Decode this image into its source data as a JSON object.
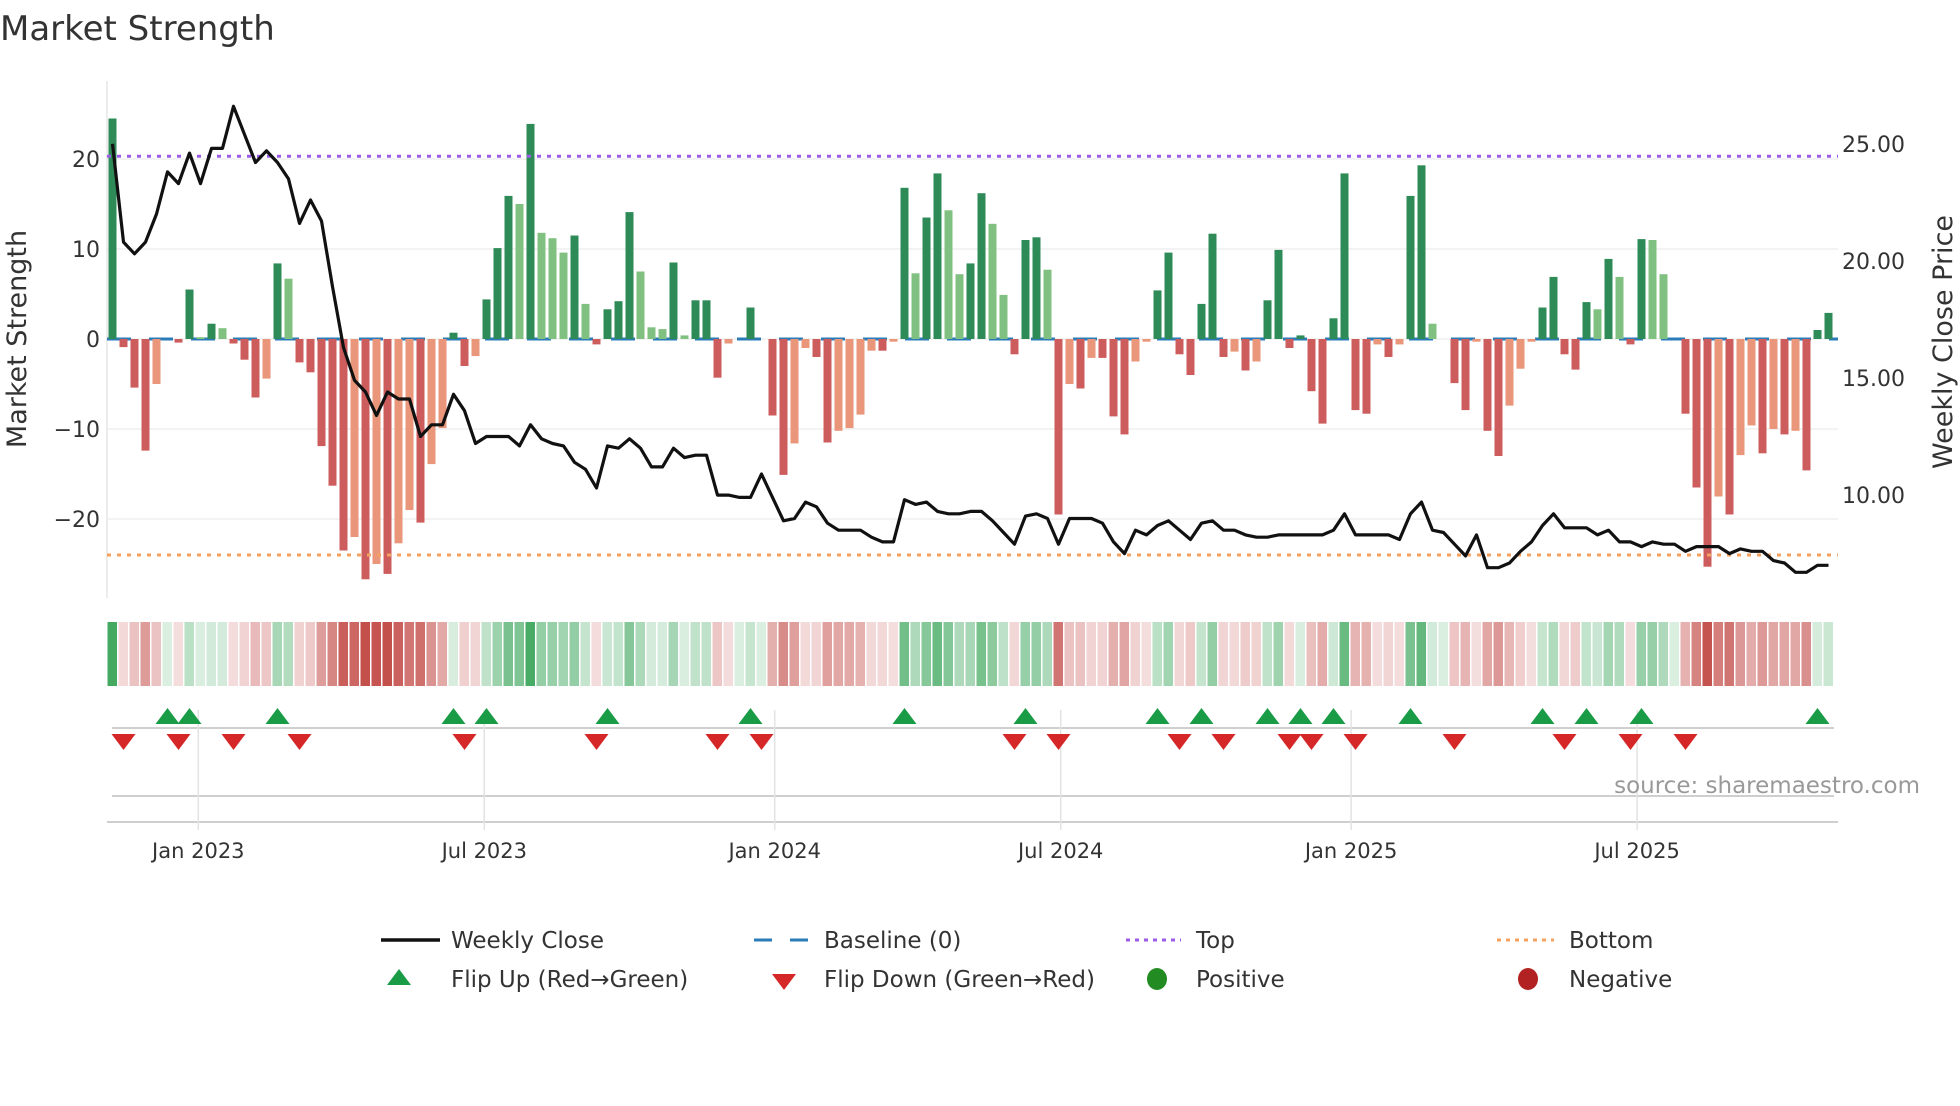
{
  "title": "Market Strength",
  "source": "source: sharemaestro.com",
  "colors": {
    "strong_pos": "#2e8b57",
    "weak_pos": "#80c080",
    "strong_neg": "#cd5c5c",
    "weak_neg": "#e9967a",
    "baseline": "#2b7bb9",
    "top": "#9b5de5",
    "bottom": "#f4a261",
    "close": "#111111",
    "flip_up": "#1a9c47",
    "flip_down": "#d62728",
    "positive": "#228b22",
    "negative": "#b22222"
  },
  "legend": {
    "weekly_close": "Weekly Close",
    "baseline": "Baseline (0)",
    "top": "Top",
    "bottom": "Bottom",
    "flip_up": "Flip Up (Red→Green)",
    "flip_down": "Flip Down (Green→Red)",
    "positive": "Positive",
    "negative": "Negative"
  },
  "chart_data": {
    "type": "bar",
    "title": "Market Strength",
    "ylabel": "Market Strength",
    "y2label": "Weekly Close Price",
    "ylim": [
      -28.7,
      28.6
    ],
    "y2lim": [
      5.6,
      27.7
    ],
    "yticks": [
      "20",
      "10",
      "0",
      "−10",
      "−20"
    ],
    "ytick_values": [
      20,
      10,
      0,
      -10,
      -20
    ],
    "y2ticks": [
      "25.00",
      "20.00",
      "15.00",
      "10.00"
    ],
    "y2tick_values": [
      25,
      20,
      15,
      10
    ],
    "xticks": [
      "Jan 2023",
      "Jul 2023",
      "Jan 2024",
      "Jul 2024",
      "Jan 2025",
      "Jul 2025"
    ],
    "xtick_week_index": [
      7.8,
      33.8,
      60.2,
      86.2,
      112.6,
      138.6
    ],
    "top_level": 20.3,
    "bottom_level": -24,
    "baseline": 0,
    "strength": [
      24.5,
      -0.9,
      -5.4,
      -12.4,
      -5,
      0,
      -0.4,
      5.5,
      0.2,
      1.7,
      1.2,
      -0.5,
      -2.3,
      -6.5,
      -4.4,
      8.4,
      6.7,
      -2.6,
      -3.7,
      -11.9,
      -16.3,
      -23.5,
      -22,
      -26.7,
      -25,
      -26.1,
      -22.7,
      -19,
      -20.4,
      -13.9,
      -9.9,
      0.7,
      -3,
      -1.9,
      4.4,
      10.1,
      15.9,
      15,
      23.9,
      11.8,
      11.2,
      9.6,
      11.5,
      3.9,
      -0.6,
      3.3,
      4.2,
      14.1,
      7.5,
      1.3,
      1.1,
      8.5,
      0.4,
      4.3,
      4.3,
      -4.3,
      -0.5,
      0,
      3.5,
      0,
      -8.5,
      -15.1,
      -11.6,
      -1,
      -2,
      -11.5,
      -10.2,
      -9.9,
      -8.4,
      -1.3,
      -1.3,
      -0.3,
      16.8,
      7.3,
      13.5,
      18.4,
      14.3,
      7.2,
      8.4,
      16.2,
      12.8,
      4.9,
      -1.7,
      11,
      11.3,
      7.7,
      -19.5,
      -5,
      -5.5,
      -2.1,
      -2.1,
      -8.6,
      -10.6,
      -2.5,
      -0.3,
      5.4,
      9.6,
      -1.7,
      -4,
      3.9,
      11.7,
      -2,
      -1.4,
      -3.5,
      -2.5,
      4.3,
      9.9,
      -1,
      0.4,
      -5.8,
      -9.4,
      2.3,
      18.4,
      -7.9,
      -8.3,
      -0.6,
      -2,
      -0.6,
      15.9,
      19.3,
      1.7,
      0,
      -4.9,
      -7.9,
      -0.3,
      -10.2,
      -13,
      -7.4,
      -3.3,
      -0.3,
      3.5,
      6.9,
      -1.7,
      -3.4,
      4.1,
      3.3,
      8.9,
      6.9,
      -0.6,
      11.1,
      11,
      7.2,
      0,
      -8.3,
      -16.5,
      -25.3,
      -17.5,
      -19.5,
      -12.9,
      -9.6,
      -12.7,
      -10,
      -10.6,
      -10.2,
      -14.6,
      1,
      2.9
    ],
    "weekly_close": [
      25.0,
      20.8,
      20.3,
      20.8,
      22.0,
      23.8,
      23.3,
      24.6,
      23.3,
      24.8,
      24.8,
      26.6,
      25.4,
      24.2,
      24.7,
      24.2,
      23.5,
      21.6,
      22.6,
      21.7,
      18.9,
      16.3,
      14.9,
      14.4,
      13.4,
      14.4,
      14.1,
      14.1,
      12.5,
      13.0,
      13.0,
      14.3,
      13.6,
      12.2,
      12.5,
      12.5,
      12.5,
      12.1,
      13.0,
      12.4,
      12.2,
      12.1,
      11.4,
      11.1,
      10.3,
      12.1,
      12.0,
      12.4,
      12.0,
      11.2,
      11.2,
      12.0,
      11.6,
      11.7,
      11.7,
      10.0,
      10.0,
      9.9,
      9.9,
      10.9,
      9.9,
      8.9,
      9.0,
      9.7,
      9.5,
      8.8,
      8.5,
      8.5,
      8.5,
      8.2,
      8.0,
      8.0,
      9.8,
      9.6,
      9.7,
      9.3,
      9.2,
      9.2,
      9.3,
      9.3,
      8.9,
      8.4,
      7.9,
      9.1,
      9.2,
      9.0,
      7.9,
      9.0,
      9.0,
      9.0,
      8.8,
      8.0,
      7.5,
      8.5,
      8.3,
      8.7,
      8.9,
      8.5,
      8.1,
      8.8,
      8.9,
      8.5,
      8.5,
      8.3,
      8.2,
      8.2,
      8.3,
      8.3,
      8.3,
      8.3,
      8.3,
      8.5,
      9.2,
      8.3,
      8.3,
      8.3,
      8.3,
      8.1,
      9.2,
      9.7,
      8.5,
      8.4,
      7.9,
      7.4,
      8.3,
      6.9,
      6.9,
      7.1,
      7.6,
      8.0,
      8.7,
      9.2,
      8.6,
      8.6,
      8.6,
      8.3,
      8.5,
      8.0,
      8.0,
      7.8,
      8.0,
      7.9,
      7.9,
      7.6,
      7.8,
      7.8,
      7.8,
      7.5,
      7.7,
      7.6,
      7.6,
      7.2,
      7.1,
      6.7,
      6.7,
      7.0,
      7.0
    ],
    "flip_up_index": [
      5,
      7,
      15,
      31,
      34,
      45,
      58,
      72,
      83,
      95,
      99,
      105,
      108,
      111,
      118,
      130,
      134,
      139,
      155
    ],
    "flip_down_index": [
      1,
      6,
      11,
      17,
      32,
      44,
      55,
      59,
      82,
      86,
      97,
      101,
      107,
      109,
      113,
      122,
      132,
      138,
      143
    ],
    "legend_position": "bottom-center"
  }
}
